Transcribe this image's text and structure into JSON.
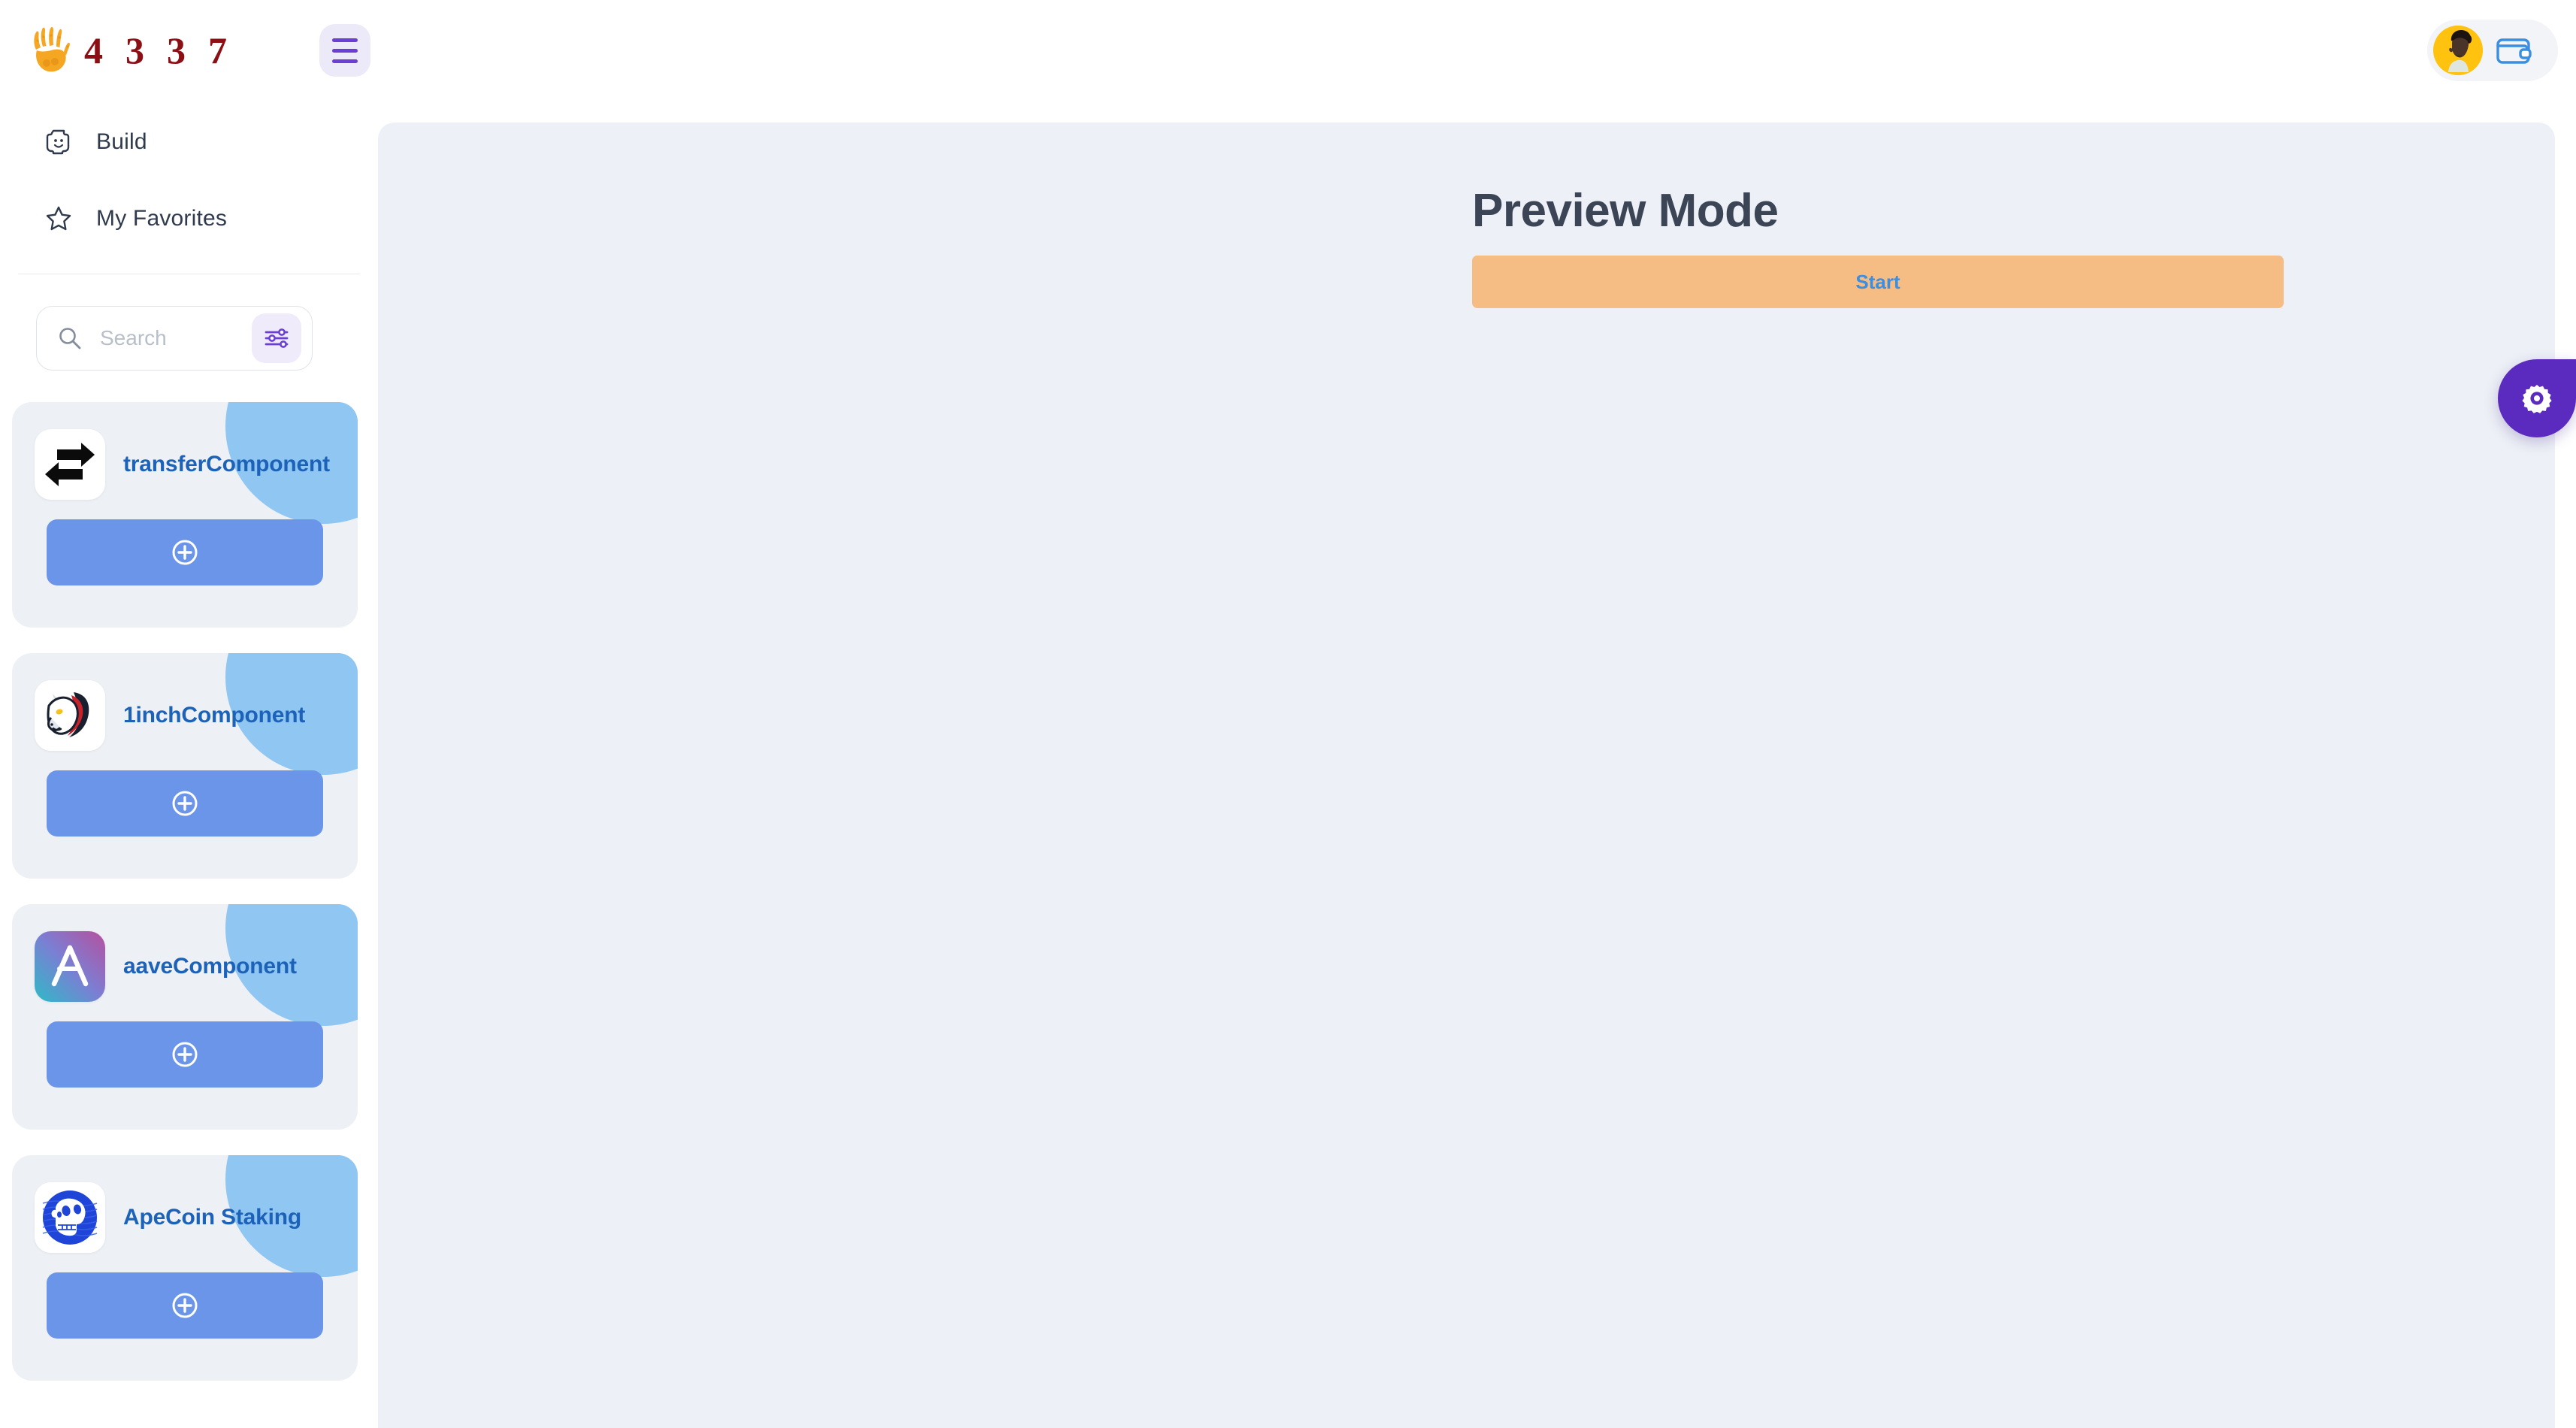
{
  "brand": {
    "logo_icon": "flame-hand-icon",
    "digits": [
      "4",
      "3",
      "3",
      "7"
    ],
    "digit_color": "#8b0f14",
    "logo_color": "#f5a623"
  },
  "topbar": {
    "menu_button_label": "menu-toggle",
    "account": {
      "avatar_label": "user-avatar",
      "wallet_icon": "wallet-icon",
      "wallet_color": "#3b8ee0"
    }
  },
  "sidebar": {
    "nav": [
      {
        "label": "Build",
        "icon": "lego-head-icon"
      },
      {
        "label": "My Favorites",
        "icon": "star-icon"
      }
    ],
    "search": {
      "placeholder": "Search",
      "value": "",
      "icon": "search-icon",
      "filter_icon": "sliders-icon",
      "filter_color": "#6b3fd4"
    },
    "components": [
      {
        "title": "transferComponent",
        "icon": "transfer-arrows-icon",
        "add_label": "add-component"
      },
      {
        "title": "1inchComponent",
        "icon": "1inch-unicorn-icon",
        "add_label": "add-component"
      },
      {
        "title": "aaveComponent",
        "icon": "aave-ghost-icon",
        "add_label": "add-component"
      },
      {
        "title": "ApeCoin Staking",
        "icon": "apecoin-skull-icon",
        "add_label": "add-component"
      }
    ]
  },
  "main": {
    "title": "Preview Mode",
    "start_label": "Start",
    "start_bg": "#f5bd84",
    "start_text_color": "#3b8ee0",
    "panel_bg": "#edf0f6"
  },
  "settings": {
    "icon": "gear-icon",
    "color": "#5b2bbf"
  }
}
